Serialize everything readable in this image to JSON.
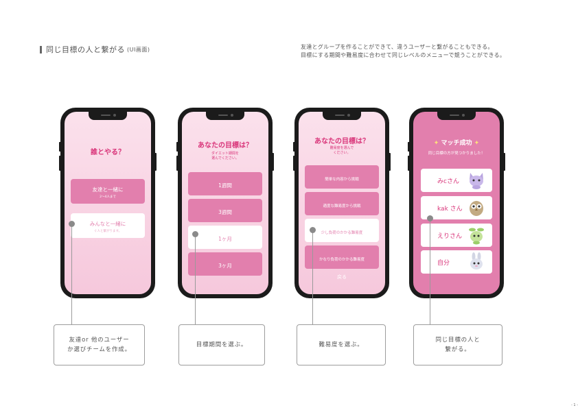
{
  "heading": {
    "title": "同じ目標の人と繋がる",
    "sub": "(UI画面)"
  },
  "description": [
    "友達とグループを作ることができて、違うユーザーと繋がることもできる。",
    "目標にする期間や難易度に合わせて同じレベルのメニューで競うことができる。"
  ],
  "screen1": {
    "title": "誰とやる？",
    "options": [
      {
        "label": "友達と一緒に",
        "sub": "2～4人まで"
      },
      {
        "label": "みんなと一緒に",
        "sub": "ぐ人と繋がります。"
      }
    ]
  },
  "screen2": {
    "title": "あなたの目標は？",
    "subtitle": "ダイエット期間を\n選んでください。",
    "options": [
      "1週間",
      "3週間",
      "1ヶ月",
      "3ヶ月"
    ]
  },
  "screen3": {
    "title": "あなたの目標は？",
    "subtitle": "難易度を選んで\nください。",
    "options": [
      "簡単な内容から挑戦",
      "適度な難易度から挑戦",
      "少し負荷のかかる難易度",
      "かなり負荷のかかる難易度"
    ],
    "back": "戻る"
  },
  "screen4": {
    "title": "マッチ成功",
    "spark": "✦",
    "subtitle": "同じ目標の方が見つかりました！",
    "matches": [
      {
        "name": "みcさん",
        "icon": "purple-cat-icon",
        "color": "#b9a5e0"
      },
      {
        "name": "kak さん",
        "icon": "brown-owl-icon",
        "color": "#b8a07a"
      },
      {
        "name": "えりさん",
        "icon": "green-sprout-icon",
        "color": "#b8dc8a"
      },
      {
        "name": "自分",
        "icon": "grey-bunny-icon",
        "color": "#c9cde0"
      }
    ]
  },
  "captions": {
    "c1": "友達or 他のユーザー\nか選びチームを作成。",
    "c2": "目標期間を選ぶ。",
    "c3": "難易度を選ぶ。",
    "c4": "同じ目標の人と\n繋がる。"
  },
  "page_number": "- 1 -",
  "colors": {
    "accent": "#d9357a",
    "pink": "#e27fad",
    "screen_light": "#fbe1ec"
  }
}
